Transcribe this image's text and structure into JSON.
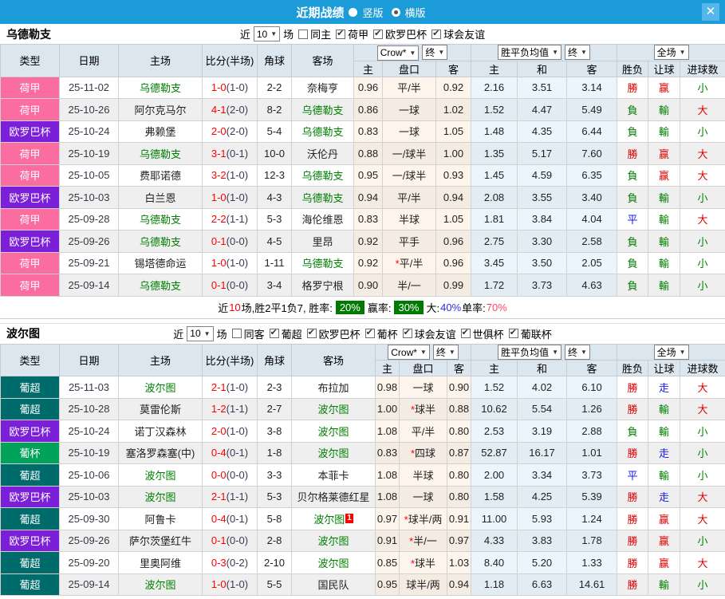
{
  "titlebar": {
    "title": "近期战绩",
    "view_options": [
      {
        "label": "竖版",
        "checked": false
      },
      {
        "label": "横版",
        "checked": true
      }
    ],
    "close": "✕"
  },
  "table_header": {
    "static_cols": [
      "类型",
      "日期",
      "主场",
      "比分(半场)",
      "角球",
      "客场"
    ],
    "odds_group": {
      "select1": "Crow*",
      "select2": "终",
      "cols": [
        "主",
        "盘口",
        "客"
      ]
    },
    "avg_group": {
      "select1": "胜平负均值",
      "select2": "终",
      "cols": [
        "主",
        "和",
        "客"
      ]
    },
    "full_group": {
      "select": "全场",
      "cols": [
        "胜负",
        "让球",
        "进球数"
      ]
    }
  },
  "colors": {
    "league": {
      "荷甲": "#fb6da1",
      "欧罗巴杯": "#7b1fd9",
      "葡超": "#006b6b",
      "葡杯": "#00a359"
    },
    "outcome_class": {
      "勝": "res-r",
      "赢": "res-r",
      "大": "res-r",
      "負": "res-g",
      "輸": "res-g",
      "小": "res-g",
      "平": "res-b",
      "走": "res-b"
    }
  },
  "sections": [
    {
      "team": "乌德勒支",
      "filter": {
        "prefix": "近",
        "count": "10",
        "suffix": "场",
        "same": {
          "label": "同主",
          "checked": false
        },
        "leagues": [
          {
            "label": "荷甲",
            "checked": true
          },
          {
            "label": "欧罗巴杯",
            "checked": true
          },
          {
            "label": "球会友谊",
            "checked": true
          }
        ]
      },
      "rows": [
        {
          "lg": "荷甲",
          "date": "25-11-02",
          "home": "乌德勒支",
          "hs": 1,
          "score": "1-0",
          "half": "(1-0)",
          "corner": "2-2",
          "away": "奈梅亨",
          "as": 0,
          "o1": "0.96",
          "star": 0,
          "hc": "平/半",
          "o2": "0.92",
          "a1": "2.16",
          "a2": "3.51",
          "a3": "3.14",
          "r1": "勝",
          "r2": "赢",
          "r3": "小"
        },
        {
          "lg": "荷甲",
          "date": "25-10-26",
          "home": "阿尔克马尔",
          "hs": 0,
          "score": "4-1",
          "half": "(2-0)",
          "corner": "8-2",
          "away": "乌德勒支",
          "as": 1,
          "o1": "0.86",
          "star": 0,
          "hc": "一球",
          "o2": "1.02",
          "a1": "1.52",
          "a2": "4.47",
          "a3": "5.49",
          "r1": "負",
          "r2": "輸",
          "r3": "大"
        },
        {
          "lg": "欧罗巴杯",
          "date": "25-10-24",
          "home": "弗赖堡",
          "hs": 0,
          "score": "2-0",
          "half": "(2-0)",
          "corner": "5-4",
          "away": "乌德勒支",
          "as": 1,
          "o1": "0.83",
          "star": 0,
          "hc": "一球",
          "o2": "1.05",
          "a1": "1.48",
          "a2": "4.35",
          "a3": "6.44",
          "r1": "負",
          "r2": "輸",
          "r3": "小"
        },
        {
          "lg": "荷甲",
          "date": "25-10-19",
          "home": "乌德勒支",
          "hs": 1,
          "score": "3-1",
          "half": "(0-1)",
          "corner": "10-0",
          "away": "沃伦丹",
          "as": 0,
          "o1": "0.88",
          "star": 0,
          "hc": "一/球半",
          "o2": "1.00",
          "a1": "1.35",
          "a2": "5.17",
          "a3": "7.60",
          "r1": "勝",
          "r2": "赢",
          "r3": "大"
        },
        {
          "lg": "荷甲",
          "date": "25-10-05",
          "home": "费耶诺德",
          "hs": 0,
          "score": "3-2",
          "half": "(1-0)",
          "corner": "12-3",
          "away": "乌德勒支",
          "as": 1,
          "o1": "0.95",
          "star": 0,
          "hc": "一/球半",
          "o2": "0.93",
          "a1": "1.45",
          "a2": "4.59",
          "a3": "6.35",
          "r1": "負",
          "r2": "赢",
          "r3": "大"
        },
        {
          "lg": "欧罗巴杯",
          "date": "25-10-03",
          "home": "白兰恩",
          "hs": 0,
          "score": "1-0",
          "half": "(1-0)",
          "corner": "4-3",
          "away": "乌德勒支",
          "as": 1,
          "o1": "0.94",
          "star": 0,
          "hc": "平/半",
          "o2": "0.94",
          "a1": "2.08",
          "a2": "3.55",
          "a3": "3.40",
          "r1": "負",
          "r2": "輸",
          "r3": "小"
        },
        {
          "lg": "荷甲",
          "date": "25-09-28",
          "home": "乌德勒支",
          "hs": 1,
          "score": "2-2",
          "half": "(1-1)",
          "corner": "5-3",
          "away": "海伦维恩",
          "as": 0,
          "o1": "0.83",
          "star": 0,
          "hc": "半球",
          "o2": "1.05",
          "a1": "1.81",
          "a2": "3.84",
          "a3": "4.04",
          "r1": "平",
          "r2": "輸",
          "r3": "大"
        },
        {
          "lg": "欧罗巴杯",
          "date": "25-09-26",
          "home": "乌德勒支",
          "hs": 1,
          "score": "0-1",
          "half": "(0-0)",
          "corner": "4-5",
          "away": "里昂",
          "as": 0,
          "o1": "0.92",
          "star": 0,
          "hc": "平手",
          "o2": "0.96",
          "a1": "2.75",
          "a2": "3.30",
          "a3": "2.58",
          "r1": "負",
          "r2": "輸",
          "r3": "小"
        },
        {
          "lg": "荷甲",
          "date": "25-09-21",
          "home": "锡塔德命运",
          "hs": 0,
          "score": "1-0",
          "half": "(1-0)",
          "corner": "1-11",
          "away": "乌德勒支",
          "as": 1,
          "o1": "0.92",
          "star": 1,
          "hc": "平/半",
          "o2": "0.96",
          "a1": "3.45",
          "a2": "3.50",
          "a3": "2.05",
          "r1": "負",
          "r2": "輸",
          "r3": "小"
        },
        {
          "lg": "荷甲",
          "date": "25-09-14",
          "home": "乌德勒支",
          "hs": 1,
          "score": "0-1",
          "half": "(0-0)",
          "corner": "3-4",
          "away": "格罗宁根",
          "as": 0,
          "o1": "0.90",
          "star": 0,
          "hc": "半/一",
          "o2": "0.99",
          "a1": "1.72",
          "a2": "3.73",
          "a3": "4.63",
          "r1": "負",
          "r2": "輸",
          "r3": "小"
        }
      ],
      "summary": [
        {
          "t": "近"
        },
        {
          "t": "10",
          "s": "red"
        },
        {
          "t": "场,胜2平1负7, 胜率:"
        },
        {
          "t": "20%",
          "s": "badge"
        },
        {
          "t": "赢率:"
        },
        {
          "t": "30%",
          "s": "badge"
        },
        {
          "t": "大:"
        },
        {
          "t": "40%",
          "s": "blue"
        },
        {
          "t": " 单率:"
        },
        {
          "t": "70%",
          "s": "pink"
        }
      ]
    },
    {
      "team": "波尔图",
      "filter": {
        "prefix": "近",
        "count": "10",
        "suffix": "场",
        "same": {
          "label": "同客",
          "checked": false
        },
        "leagues": [
          {
            "label": "葡超",
            "checked": true
          },
          {
            "label": "欧罗巴杯",
            "checked": true
          },
          {
            "label": "葡杯",
            "checked": true
          },
          {
            "label": "球会友谊",
            "checked": true
          },
          {
            "label": "世俱杯",
            "checked": true
          },
          {
            "label": "葡联杯",
            "checked": true
          }
        ]
      },
      "rows": [
        {
          "lg": "葡超",
          "date": "25-11-03",
          "home": "波尔图",
          "hs": 1,
          "score": "2-1",
          "half": "(1-0)",
          "corner": "2-3",
          "away": "布拉加",
          "as": 0,
          "o1": "0.98",
          "star": 0,
          "hc": "一球",
          "o2": "0.90",
          "a1": "1.52",
          "a2": "4.02",
          "a3": "6.10",
          "r1": "勝",
          "r2": "走",
          "r3": "大"
        },
        {
          "lg": "葡超",
          "date": "25-10-28",
          "home": "莫雷伦斯",
          "hs": 0,
          "score": "1-2",
          "half": "(1-1)",
          "corner": "2-7",
          "away": "波尔图",
          "as": 1,
          "o1": "1.00",
          "star": 1,
          "hc": "球半",
          "o2": "0.88",
          "a1": "10.62",
          "a2": "5.54",
          "a3": "1.26",
          "r1": "勝",
          "r2": "輸",
          "r3": "大"
        },
        {
          "lg": "欧罗巴杯",
          "date": "25-10-24",
          "home": "诺丁汉森林",
          "hs": 0,
          "score": "2-0",
          "half": "(1-0)",
          "corner": "3-8",
          "away": "波尔图",
          "as": 1,
          "o1": "1.08",
          "star": 0,
          "hc": "平/半",
          "o2": "0.80",
          "a1": "2.53",
          "a2": "3.19",
          "a3": "2.88",
          "r1": "負",
          "r2": "輸",
          "r3": "小"
        },
        {
          "lg": "葡杯",
          "date": "25-10-19",
          "home": "塞洛罗森塞(中)",
          "hs": 0,
          "score": "0-4",
          "half": "(0-1)",
          "corner": "1-8",
          "away": "波尔图",
          "as": 1,
          "o1": "0.83",
          "star": 1,
          "hc": "四球",
          "o2": "0.87",
          "a1": "52.87",
          "a2": "16.17",
          "a3": "1.01",
          "r1": "勝",
          "r2": "走",
          "r3": "小"
        },
        {
          "lg": "葡超",
          "date": "25-10-06",
          "home": "波尔图",
          "hs": 1,
          "score": "0-0",
          "half": "(0-0)",
          "corner": "3-3",
          "away": "本菲卡",
          "as": 0,
          "o1": "1.08",
          "star": 0,
          "hc": "半球",
          "o2": "0.80",
          "a1": "2.00",
          "a2": "3.34",
          "a3": "3.73",
          "r1": "平",
          "r2": "輸",
          "r3": "小"
        },
        {
          "lg": "欧罗巴杯",
          "date": "25-10-03",
          "home": "波尔图",
          "hs": 1,
          "score": "2-1",
          "half": "(1-1)",
          "corner": "5-3",
          "away": "贝尔格莱德红星",
          "as": 0,
          "o1": "1.08",
          "star": 0,
          "hc": "一球",
          "o2": "0.80",
          "a1": "1.58",
          "a2": "4.25",
          "a3": "5.39",
          "r1": "勝",
          "r2": "走",
          "r3": "大"
        },
        {
          "lg": "葡超",
          "date": "25-09-30",
          "home": "阿鲁卡",
          "hs": 0,
          "score": "0-4",
          "half": "(0-1)",
          "corner": "5-8",
          "away": "波尔图",
          "as": 1,
          "card": "1",
          "o1": "0.97",
          "star": 1,
          "hc": "球半/两",
          "o2": "0.91",
          "a1": "11.00",
          "a2": "5.93",
          "a3": "1.24",
          "r1": "勝",
          "r2": "赢",
          "r3": "大"
        },
        {
          "lg": "欧罗巴杯",
          "date": "25-09-26",
          "home": "萨尔茨堡红牛",
          "hs": 0,
          "score": "0-1",
          "half": "(0-0)",
          "corner": "2-8",
          "away": "波尔图",
          "as": 1,
          "o1": "0.91",
          "star": 1,
          "hc": "半/一",
          "o2": "0.97",
          "a1": "4.33",
          "a2": "3.83",
          "a3": "1.78",
          "r1": "勝",
          "r2": "赢",
          "r3": "小"
        },
        {
          "lg": "葡超",
          "date": "25-09-20",
          "home": "里奥阿维",
          "hs": 0,
          "score": "0-3",
          "half": "(0-2)",
          "corner": "2-10",
          "away": "波尔图",
          "as": 1,
          "o1": "0.85",
          "star": 1,
          "hc": "球半",
          "o2": "1.03",
          "a1": "8.40",
          "a2": "5.20",
          "a3": "1.33",
          "r1": "勝",
          "r2": "赢",
          "r3": "大"
        },
        {
          "lg": "葡超",
          "date": "25-09-14",
          "home": "波尔图",
          "hs": 1,
          "score": "1-0",
          "half": "(1-0)",
          "corner": "5-5",
          "away": "国民队",
          "as": 0,
          "o1": "0.95",
          "star": 0,
          "hc": "球半/两",
          "o2": "0.94",
          "a1": "1.18",
          "a2": "6.63",
          "a3": "14.61",
          "r1": "勝",
          "r2": "輸",
          "r3": "小"
        }
      ]
    }
  ]
}
